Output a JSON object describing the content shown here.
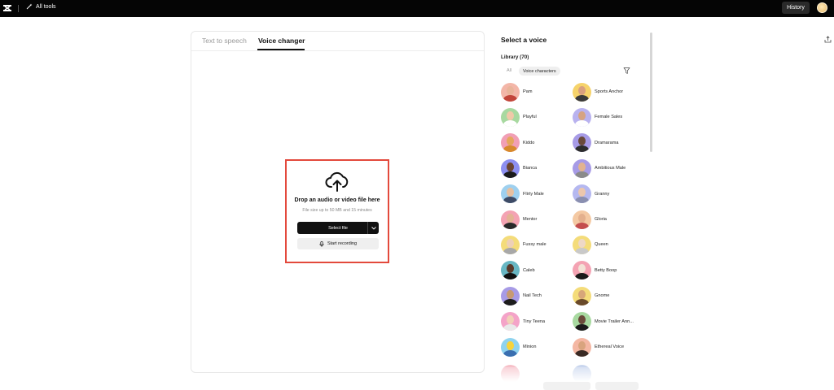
{
  "topbar": {
    "all_tools_label": "All tools",
    "history_label": "History"
  },
  "tabs": [
    {
      "label": "Text to speech"
    },
    {
      "label": "Voice changer"
    }
  ],
  "upload": {
    "title": "Drop an audio or video file here",
    "subtitle": "File size up to 50 MB and 15 minutes",
    "select_file_label": "Select file",
    "record_label": "Start recording"
  },
  "voices_panel": {
    "title": "Select a voice",
    "library_label": "Library (70)",
    "filters": [
      {
        "label": "All"
      },
      {
        "label": "Voice characters"
      }
    ],
    "voices": [
      {
        "name": "Pam",
        "bg": "#f3b6a8",
        "skin": "#e8b49a",
        "shirt": "#c2453a"
      },
      {
        "name": "Sports Anchor",
        "bg": "#f6d36b",
        "skin": "#d9a07f",
        "shirt": "#3a3a3a"
      },
      {
        "name": "Playful",
        "bg": "#a8d9a0",
        "skin": "#f0c9a8",
        "shirt": "#ffffff"
      },
      {
        "name": "Female Sales",
        "bg": "#b9b2ef",
        "skin": "#d6a382",
        "shirt": "#ffffff"
      },
      {
        "name": "Kiddo",
        "bg": "#f19fb5",
        "skin": "#e5a65c",
        "shirt": "#d88a2c"
      },
      {
        "name": "Dramarama",
        "bg": "#a79be6",
        "skin": "#6a4a3a",
        "shirt": "#2d2d2d"
      },
      {
        "name": "Bianca",
        "bg": "#8d8ff0",
        "skin": "#6b4530",
        "shirt": "#1b1b1b"
      },
      {
        "name": "Ambitious Male",
        "bg": "#a79be6",
        "skin": "#e2b38f",
        "shirt": "#8a8a8a"
      },
      {
        "name": "Flirty Male",
        "bg": "#9ed0ef",
        "skin": "#e7c0a0",
        "shirt": "#3d4b66"
      },
      {
        "name": "Granny",
        "bg": "#b5b8f0",
        "skin": "#ecc7ad",
        "shirt": "#8a8fb0"
      },
      {
        "name": "Mentor",
        "bg": "#f4a3b3",
        "skin": "#e3b394",
        "shirt": "#2a2a2a"
      },
      {
        "name": "Gloria",
        "bg": "#f4c9a3",
        "skin": "#e4b08d",
        "shirt": "#c44e4e"
      },
      {
        "name": "Fussy male",
        "bg": "#f4dc7a",
        "skin": "#eed0b7",
        "shirt": "#a8a8a8"
      },
      {
        "name": "Queen",
        "bg": "#f4dc7a",
        "skin": "#eed8c6",
        "shirt": "#c9c9c9"
      },
      {
        "name": "Caleb",
        "bg": "#68b7c3",
        "skin": "#5a3a2a",
        "shirt": "#111111"
      },
      {
        "name": "Betty Boop",
        "bg": "#f4a3b3",
        "skin": "#f3e2d6",
        "shirt": "#1a1a1a"
      },
      {
        "name": "Nail Tech",
        "bg": "#a79be6",
        "skin": "#c79a72",
        "shirt": "#1d1d1d"
      },
      {
        "name": "Gnome",
        "bg": "#f4dc7a",
        "skin": "#d7a679",
        "shirt": "#6a4a2a"
      },
      {
        "name": "Tiny Teena",
        "bg": "#f4a3c8",
        "skin": "#f1d0b8",
        "shirt": "#e9e9e9"
      },
      {
        "name": "Movie Trailer Ann...",
        "bg": "#a8d9a0",
        "skin": "#6a4a3a",
        "shirt": "#1a1a1a"
      },
      {
        "name": "Minion",
        "bg": "#8fd3ef",
        "skin": "#f7d33a",
        "shirt": "#3a6fb0"
      },
      {
        "name": "Ethereal Voice",
        "bg": "#f4b7a3",
        "skin": "#d9a47e",
        "shirt": "#3a2a24"
      }
    ]
  },
  "colors": {
    "topbar": "#050505",
    "highlight": "#e3493c",
    "primary_button": "#111111"
  },
  "icons": [
    "logo-icon",
    "magic-wand-icon",
    "cloud-upload-icon",
    "chevron-down-icon",
    "microphone-icon",
    "filter-icon",
    "upload-icon"
  ]
}
